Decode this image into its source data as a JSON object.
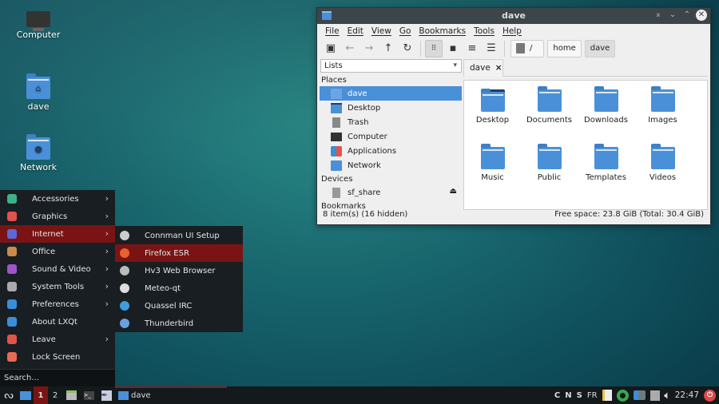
{
  "desktop": {
    "icons": [
      {
        "label": "Computer",
        "icon": "computer-icon"
      },
      {
        "label": "dave",
        "icon": "home-folder-icon"
      },
      {
        "label": "Network",
        "icon": "network-folder-icon"
      }
    ]
  },
  "window": {
    "title": "dave",
    "menubar": [
      "File",
      "Edit",
      "View",
      "Go",
      "Bookmarks",
      "Tools",
      "Help"
    ],
    "toolbar": {
      "new_tab": "new-tab-icon",
      "back": "back-icon",
      "forward": "forward-icon",
      "up": "up-icon",
      "reload": "reload-icon",
      "icon_view": "icon-view-icon",
      "thumb_view": "thumbnail-view-icon",
      "compact_view": "compact-view-icon",
      "detail_view": "detail-view-icon"
    },
    "breadcrumbs": [
      "/",
      "home",
      "dave"
    ],
    "side_mode": "Lists",
    "places_label": "Places",
    "places": [
      {
        "label": "dave",
        "icon": "home-icon"
      },
      {
        "label": "Desktop",
        "icon": "desktop-icon"
      },
      {
        "label": "Trash",
        "icon": "trash-icon"
      },
      {
        "label": "Computer",
        "icon": "computer-icon"
      },
      {
        "label": "Applications",
        "icon": "applications-icon"
      },
      {
        "label": "Network",
        "icon": "network-icon"
      }
    ],
    "devices_label": "Devices",
    "devices": [
      {
        "label": "sf_share",
        "icon": "drive-icon",
        "eject": "eject-icon"
      }
    ],
    "bookmarks_label": "Bookmarks",
    "tab": {
      "label": "dave",
      "close": "×"
    },
    "files": [
      "Desktop",
      "Documents",
      "Downloads",
      "Images",
      "Music",
      "Public",
      "Templates",
      "Videos"
    ],
    "status_left": "8 item(s) (16 hidden)",
    "status_right": "Free space: 23.8 GiB (Total: 30.4 GiB)"
  },
  "menu": {
    "items": [
      {
        "label": "Accessories",
        "color": "#3cb08a",
        "sub": true
      },
      {
        "label": "Graphics",
        "color": "#e0534c",
        "sub": true
      },
      {
        "label": "Internet",
        "color": "#5a68d8",
        "sub": true
      },
      {
        "label": "Office",
        "color": "#c98a4b",
        "sub": true
      },
      {
        "label": "Sound & Video",
        "color": "#a054c8",
        "sub": true
      },
      {
        "label": "System Tools",
        "color": "#aaaaaa",
        "sub": true
      },
      {
        "label": "Preferences",
        "color": "#3a8ed8",
        "sub": true
      },
      {
        "label": "About LXQt",
        "color": "#3a8ed8",
        "sub": false
      },
      {
        "label": "Leave",
        "color": "#e05548",
        "sub": true
      },
      {
        "label": "Lock Screen",
        "color": "#e86a50",
        "sub": false
      }
    ],
    "search_placeholder": "Search...",
    "arrow": "›",
    "active_index": 2
  },
  "submenu": {
    "items": [
      {
        "label": "Connman UI Setup",
        "color": "#cccccc"
      },
      {
        "label": "Firefox ESR",
        "color": "#e8632c"
      },
      {
        "label": "Hv3 Web Browser",
        "color": "#bbbbbb"
      },
      {
        "label": "Meteo-qt",
        "color": "#dddddd"
      },
      {
        "label": "Quassel IRC",
        "color": "#3c9ee0"
      },
      {
        "label": "Thunderbird",
        "color": "#6a9fe0"
      }
    ],
    "active_index": 1
  },
  "taskbar": {
    "desktops": [
      "1",
      "2"
    ],
    "task": "dave",
    "tray_keys": [
      "C",
      "N",
      "S"
    ],
    "layout": "FR",
    "clock": "22:47"
  },
  "colors": {
    "accent": "#4a90d9",
    "menu_active": "#7a1414",
    "menu_bg": "#181e22",
    "taskbar": "#14191c"
  }
}
